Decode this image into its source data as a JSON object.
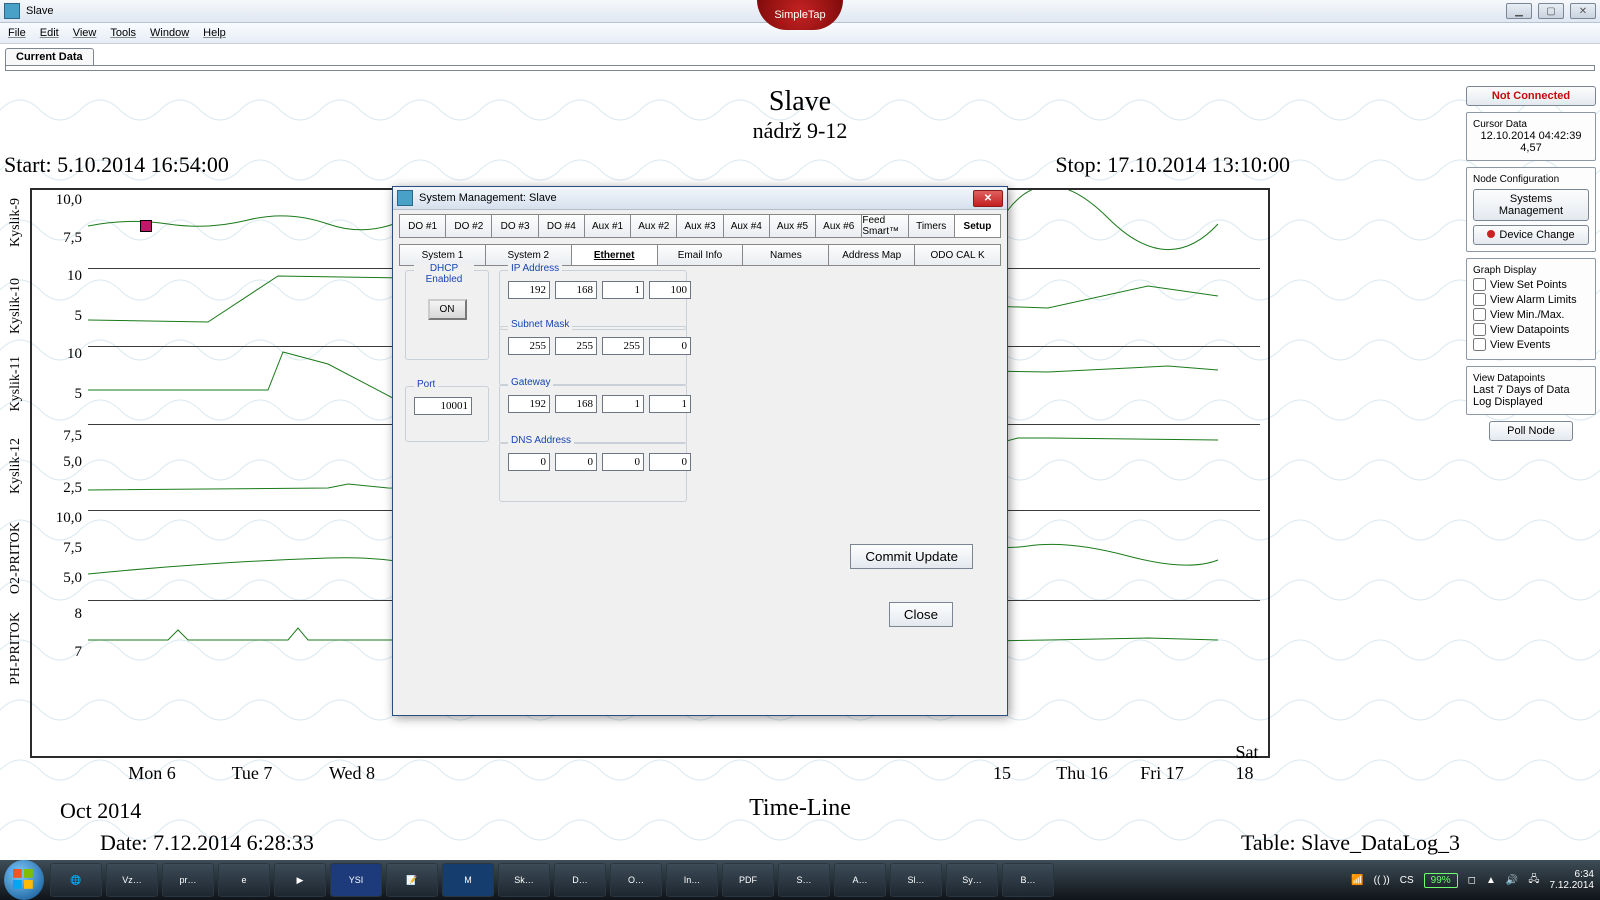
{
  "window": {
    "title": "Slave"
  },
  "simpletap": "SimpleTap",
  "menu": [
    "File",
    "Edit",
    "View",
    "Tools",
    "Window",
    "Help"
  ],
  "tab_current": "Current Data",
  "chart": {
    "title": "Slave",
    "subtitle": "nádrž 9-12",
    "start": "Start: 5.10.2014 16:54:00",
    "stop": "Stop: 17.10.2014 13:10:00",
    "xaxis": "Time-Line",
    "month": "Oct 2014",
    "footer_date": "Date: 7.12.2014 6:28:33",
    "footer_table": "Table: Slave_DataLog_3"
  },
  "yaxes": [
    "Kyslik-9",
    "Kyslik-10",
    "Kyslik-11",
    "Kyslik-12",
    "O2-PRITOK",
    "PH-PRITOK"
  ],
  "xticks": [
    "Mon 6",
    "Tue 7",
    "Wed 8",
    "15",
    "Thu 16",
    "Fri 17",
    "Sat 18"
  ],
  "right": {
    "not_connected": "Not Connected",
    "cursor_head": "Cursor Data",
    "cursor_l1": "12.10.2014 04:42:39",
    "cursor_l2": "4,57",
    "nodecfg_head": "Node Configuration",
    "sysmgmt": "Systems\nManagement",
    "devchg": "Device Change",
    "disp_head": "Graph Display",
    "cb": [
      "View Set Points",
      "View Alarm Limits",
      "View Min./Max.",
      "View Datapoints",
      "View Events"
    ],
    "vdp_head": "View Datapoints",
    "vdp_body": "Last 7 Days of Data Log Displayed",
    "poll": "Poll Node"
  },
  "modal": {
    "title": "System Management: Slave",
    "tabs1": [
      "DO #1",
      "DO #2",
      "DO #3",
      "DO #4",
      "Aux #1",
      "Aux #2",
      "Aux #3",
      "Aux #4",
      "Aux #5",
      "Aux #6",
      "Feed Smart™",
      "Timers",
      "Setup"
    ],
    "tabs2": [
      "System 1",
      "System 2",
      "Ethernet",
      "Email Info",
      "Names",
      "Address Map",
      "ODO CAL K"
    ],
    "dhcp_head": "DHCP Enabled",
    "dhcp_btn": "ON",
    "port_head": "Port",
    "port": "10001",
    "ip_head": "IP Address",
    "ip": [
      "192",
      "168",
      "1",
      "100"
    ],
    "sm_head": "Subnet Mask",
    "sm": [
      "255",
      "255",
      "255",
      "0"
    ],
    "gw_head": "Gateway",
    "gw": [
      "192",
      "168",
      "1",
      "1"
    ],
    "dns_head": "DNS Address",
    "dns": [
      "0",
      "0",
      "0",
      "0"
    ],
    "commit": "Commit Update",
    "close": "Close"
  },
  "tray": {
    "lang": "CS",
    "batt": "99%",
    "time": "6:34",
    "date": "7.12.2014"
  },
  "task_items": [
    "Vz…",
    "pr…",
    "",
    "",
    "",
    "",
    "",
    "Sk…",
    "D…",
    "O…",
    "In…",
    "…",
    "S…",
    "A…",
    "Sl…",
    "Sy…",
    "B…"
  ],
  "chart_data": {
    "type": "line",
    "xaxis": "Time-Line",
    "x_range": [
      "5.10.2014 16:54",
      "17.10.2014 13:10"
    ],
    "series": [
      {
        "name": "Kyslik-9",
        "yticks": [
          7.5,
          10.0
        ],
        "approx_range_y": [
          7.0,
          10.5
        ],
        "trend": "oscillating ~8–10"
      },
      {
        "name": "Kyslik-10",
        "yticks": [
          5,
          10
        ],
        "approx_range_y": [
          4,
          11
        ],
        "trend": "rises to ~10 then ~6–9"
      },
      {
        "name": "Kyslik-11",
        "yticks": [
          5,
          10
        ],
        "approx_range_y": [
          3,
          11
        ],
        "trend": "spike to 10 then decline, later ~5–8"
      },
      {
        "name": "Kyslik-12",
        "yticks": [
          2.5,
          5.0,
          7.5
        ],
        "approx_range_y": [
          2,
          8
        ],
        "trend": "mostly 2–3, step to ~7 at end"
      },
      {
        "name": "O2-PRITOK",
        "yticks": [
          5.0,
          7.5,
          10.0
        ],
        "approx_range_y": [
          5,
          10
        ],
        "trend": "~5–9 oscillating"
      },
      {
        "name": "PH-PRITOK",
        "yticks": [
          7,
          8
        ],
        "approx_range_y": [
          6.8,
          8.2
        ],
        "trend": "flat ~7.1–7.5"
      }
    ]
  }
}
